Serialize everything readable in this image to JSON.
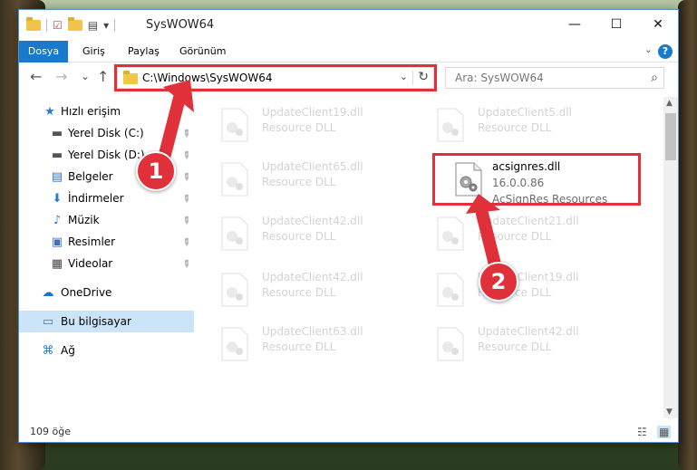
{
  "window": {
    "title": "SysWOW64",
    "minimize_glyph": "—",
    "maximize_glyph": "☐",
    "close_glyph": "✕"
  },
  "ribbon": {
    "tabs": [
      "Dosya",
      "Giriş",
      "Paylaş",
      "Görünüm"
    ],
    "expand_glyph": "⌄",
    "help_glyph": "?"
  },
  "nav": {
    "back_glyph": "←",
    "forward_glyph": "→",
    "recent_glyph": "⌄",
    "up_glyph": "↑"
  },
  "address": {
    "path": "C:\\Windows\\SysWOW64",
    "dropdown_glyph": "⌄",
    "refresh_glyph": "↻"
  },
  "search": {
    "placeholder": "Ara: SysWOW64",
    "icon_glyph": "⌕"
  },
  "sidebar": {
    "items": [
      {
        "label": "Hızlı erişim",
        "icon": "star-icon",
        "glyph": "★",
        "color": "#2a7bd4",
        "pinned": false
      },
      {
        "label": "Yerel Disk (C:)",
        "icon": "drive-icon",
        "glyph": "▬",
        "color": "#555555",
        "pinned": true
      },
      {
        "label": "Yerel Disk (D:)",
        "icon": "drive-icon",
        "glyph": "▬",
        "color": "#555555",
        "pinned": true
      },
      {
        "label": "Belgeler",
        "icon": "documents-icon",
        "glyph": "▤",
        "color": "#3b6fb6",
        "pinned": true
      },
      {
        "label": "İndirmeler",
        "icon": "download-icon",
        "glyph": "⬇",
        "color": "#2a7bd4",
        "pinned": true
      },
      {
        "label": "Müzik",
        "icon": "music-icon",
        "glyph": "♪",
        "color": "#2a7bd4",
        "pinned": true
      },
      {
        "label": "Resimler",
        "icon": "pictures-icon",
        "glyph": "▣",
        "color": "#3b6fb6",
        "pinned": true
      },
      {
        "label": "Videolar",
        "icon": "videos-icon",
        "glyph": "▦",
        "color": "#444444",
        "pinned": true
      },
      {
        "label": "OneDrive",
        "icon": "cloud-icon",
        "glyph": "☁",
        "color": "#1a6fc9",
        "pinned": false
      },
      {
        "label": "Bu bilgisayar",
        "icon": "computer-icon",
        "glyph": "▭",
        "color": "#2a7bd4",
        "pinned": false
      },
      {
        "label": "Ağ",
        "icon": "network-icon",
        "glyph": "⌘",
        "color": "#2a7bd4",
        "pinned": false
      }
    ],
    "pin_glyph": "📌"
  },
  "files": [
    {
      "name": "UpdateClient19.dll",
      "desc": "Resource DLL"
    },
    {
      "name": "UpdateClient5.dll",
      "desc": "Resource DLL"
    },
    {
      "name": "UpdateClient65.dll",
      "desc": "Resource DLL"
    },
    {
      "name": "acsignres.dll",
      "version": "16.0.0.86",
      "desc": "AcSignRes Resources"
    },
    {
      "name": "UpdateClient42.dll",
      "desc": "Resource DLL"
    },
    {
      "name": "UpdateClient21.dll",
      "desc": "Resource DLL"
    },
    {
      "name": "UpdateClient42.dll",
      "desc": "Resource DLL"
    },
    {
      "name": "UpdateClient19.dll",
      "desc": "Resource DLL"
    },
    {
      "name": "UpdateClient63.dll",
      "desc": "Resource DLL"
    },
    {
      "name": "UpdateClient42.dll",
      "desc": "Resource DLL"
    }
  ],
  "status": {
    "count": "109 öğe"
  },
  "annotations": {
    "badge1": "1",
    "badge2": "2",
    "color": "#e0303a"
  }
}
